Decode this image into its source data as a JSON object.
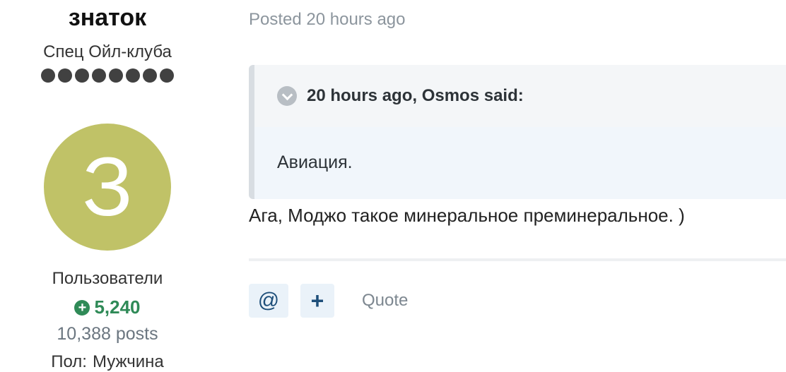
{
  "author": {
    "username": "знаток",
    "rank_title": "Спец Ойл-клуба",
    "rank_pips": 8,
    "avatar_letter": "З",
    "avatar_color": "#c0c267",
    "group": "Пользователи",
    "reputation": "5,240",
    "reputation_icon": "plus-circle-icon",
    "posts": "10,388 posts",
    "gender_label": "Пол:",
    "gender_value": "Мужчина"
  },
  "post": {
    "posted": "Posted 20 hours ago",
    "quote": {
      "header": "20 hours ago, Osmos said:",
      "body": "Авиация.",
      "toggle_icon": "chevron-down-icon"
    },
    "text": "Ага, Моджо такое минеральное преминеральное. )"
  },
  "actions": {
    "mention_label": "@",
    "add_label": "+",
    "quote_label": "Quote"
  },
  "colors": {
    "reputation": "#2f8a57",
    "accent": "#1e4f7a"
  }
}
